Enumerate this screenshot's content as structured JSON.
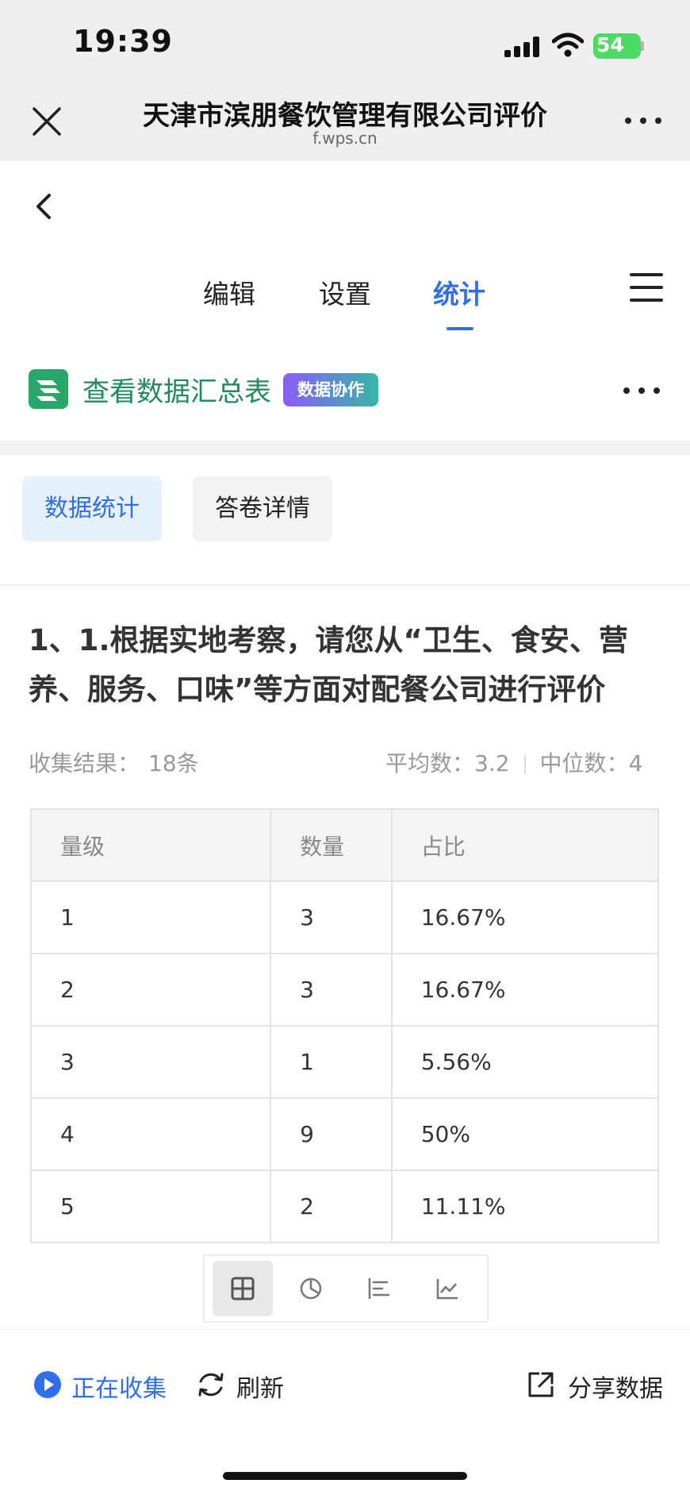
{
  "status_bar": {
    "time": "19:39",
    "battery": "54"
  },
  "browser": {
    "title": "天津市滨朋餐饮管理有限公司评价",
    "domain": "f.wps.cn"
  },
  "nav": {
    "tabs": [
      {
        "label": "编辑"
      },
      {
        "label": "设置"
      },
      {
        "label": "统计"
      }
    ]
  },
  "summary": {
    "link": "查看数据汇总表",
    "badge": "数据协作"
  },
  "subtabs": {
    "stats": "数据统计",
    "detail": "答卷详情"
  },
  "question": {
    "title": "1、1.根据实地考察，请您从“卫生、食安、营养、服务、口味”等方面对配餐公司进行评价",
    "collect_label": "收集结果：",
    "collect_value": "18条",
    "average_label": "平均数：",
    "average_value": "3.2",
    "median_label": "中位数：",
    "median_value": "4"
  },
  "table": {
    "headers": [
      "量级",
      "数量",
      "占比"
    ],
    "rows": [
      [
        "1",
        "3",
        "16.67%"
      ],
      [
        "2",
        "3",
        "16.67%"
      ],
      [
        "3",
        "1",
        "5.56%"
      ],
      [
        "4",
        "9",
        "50%"
      ],
      [
        "5",
        "2",
        "11.11%"
      ]
    ]
  },
  "view_toggle": [
    "table-icon",
    "pie-chart-icon",
    "bar-chart-icon",
    "line-chart-icon"
  ],
  "bottom": {
    "collecting": "正在收集",
    "refresh": "刷新",
    "share": "分享数据"
  },
  "colors": {
    "accent": "#2f6ee8",
    "brand_green": "#1f8b5a"
  }
}
